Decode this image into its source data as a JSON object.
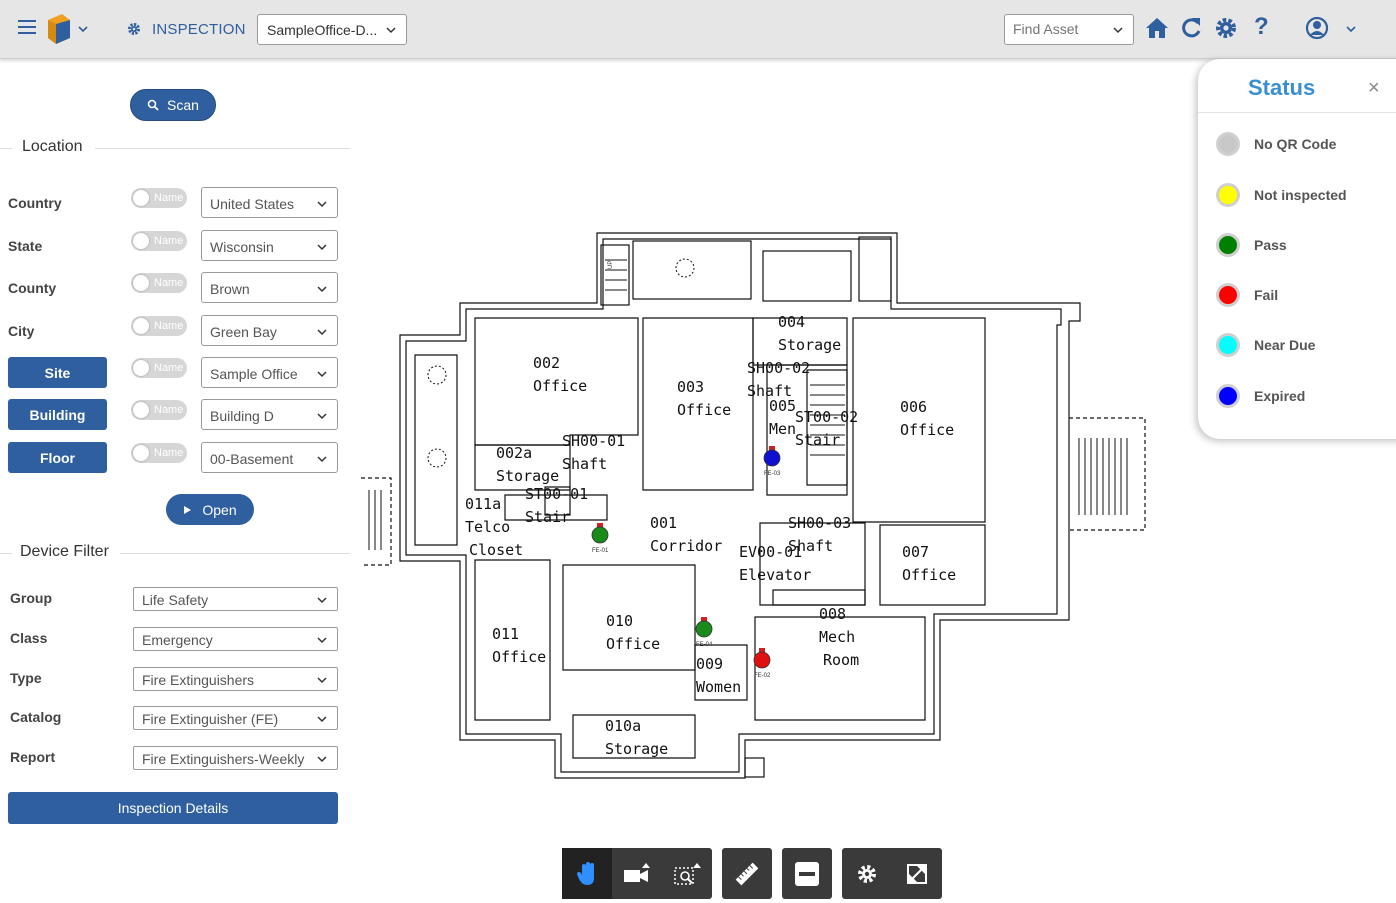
{
  "header": {
    "module_label": "INSPECTION",
    "site_select": "SampleOffice-D...",
    "find_asset_placeholder": "Find Asset"
  },
  "left": {
    "scan_label": "Scan",
    "location_title": "Location",
    "toggle_label": "Name",
    "location_rows": [
      {
        "label": "Country",
        "value": "United States",
        "button": false
      },
      {
        "label": "State",
        "value": "Wisconsin",
        "button": false
      },
      {
        "label": "County",
        "value": "Brown",
        "button": false
      },
      {
        "label": "City",
        "value": "Green Bay",
        "button": false
      },
      {
        "label": "Site",
        "value": "Sample Office",
        "button": true
      },
      {
        "label": "Building",
        "value": "Building D",
        "button": true
      },
      {
        "label": "Floor",
        "value": "00-Basement",
        "button": true
      }
    ],
    "open_label": "Open",
    "device_filter_title": "Device Filter",
    "filters": [
      {
        "label": "Group",
        "value": "Life Safety"
      },
      {
        "label": "Class",
        "value": "Emergency"
      },
      {
        "label": "Type",
        "value": "Fire Extinguishers"
      },
      {
        "label": "Catalog",
        "value": "Fire Extinguisher (FE)"
      },
      {
        "label": "Report",
        "value": "Fire Extinguishers-Weekly"
      }
    ],
    "details_label": "Inspection Details"
  },
  "status": {
    "title": "Status",
    "close": "×",
    "items": [
      {
        "label": "No QR Code",
        "color": "#c8c8c8"
      },
      {
        "label": "Not inspected",
        "color": "#ffff00"
      },
      {
        "label": "Pass",
        "color": "#008000"
      },
      {
        "label": "Fail",
        "color": "#ff0000"
      },
      {
        "label": "Near Due",
        "color": "#00ffff"
      },
      {
        "label": "Expired",
        "color": "#0000ff"
      }
    ]
  },
  "floorplan": {
    "rooms": [
      {
        "name": "002",
        "sub": "Office"
      },
      {
        "name": "003",
        "sub": "Office"
      },
      {
        "name": "004",
        "sub": "Storage"
      },
      {
        "name": "006",
        "sub": "Office"
      },
      {
        "name": "002a",
        "sub": "Storage"
      },
      {
        "name": "SH00-01",
        "sub": "Shaft"
      },
      {
        "name": "SH00-02",
        "sub": "Shaft"
      },
      {
        "name": "005",
        "sub": "Men"
      },
      {
        "name": "ST00-02",
        "sub": "Stair"
      },
      {
        "name": "011a",
        "sub": "Telco"
      },
      {
        "name": "Closet",
        "sub": ""
      },
      {
        "name": "ST00-01",
        "sub": "Stair"
      },
      {
        "name": "001",
        "sub": "Corridor"
      },
      {
        "name": "SH00-03",
        "sub": "Shaft"
      },
      {
        "name": "EV00-01",
        "sub": "Elevator"
      },
      {
        "name": "007",
        "sub": "Office"
      },
      {
        "name": "011",
        "sub": "Office"
      },
      {
        "name": "010",
        "sub": "Office"
      },
      {
        "name": "008",
        "sub": "Mech"
      },
      {
        "name": "Room",
        "sub": ""
      },
      {
        "name": "009",
        "sub": "Women"
      },
      {
        "name": "010a",
        "sub": "Storage"
      }
    ],
    "extinguishers": [
      {
        "tag": "FE-01",
        "status": "Pass",
        "color": "#1a8a1a"
      },
      {
        "tag": "FE-02",
        "status": "Fail",
        "color": "#e01010"
      },
      {
        "tag": "FE-03",
        "status": "Expired",
        "color": "#1010d0"
      },
      {
        "tag": "FE-04",
        "status": "Pass",
        "color": "#1a8a1a"
      }
    ],
    "up_label": "UP"
  },
  "toolbar": {
    "tools": [
      "pan-icon",
      "camera-icon",
      "zoom-area-icon",
      "measure-icon",
      "minus-icon",
      "settings-icon",
      "fullscreen-icon"
    ]
  }
}
